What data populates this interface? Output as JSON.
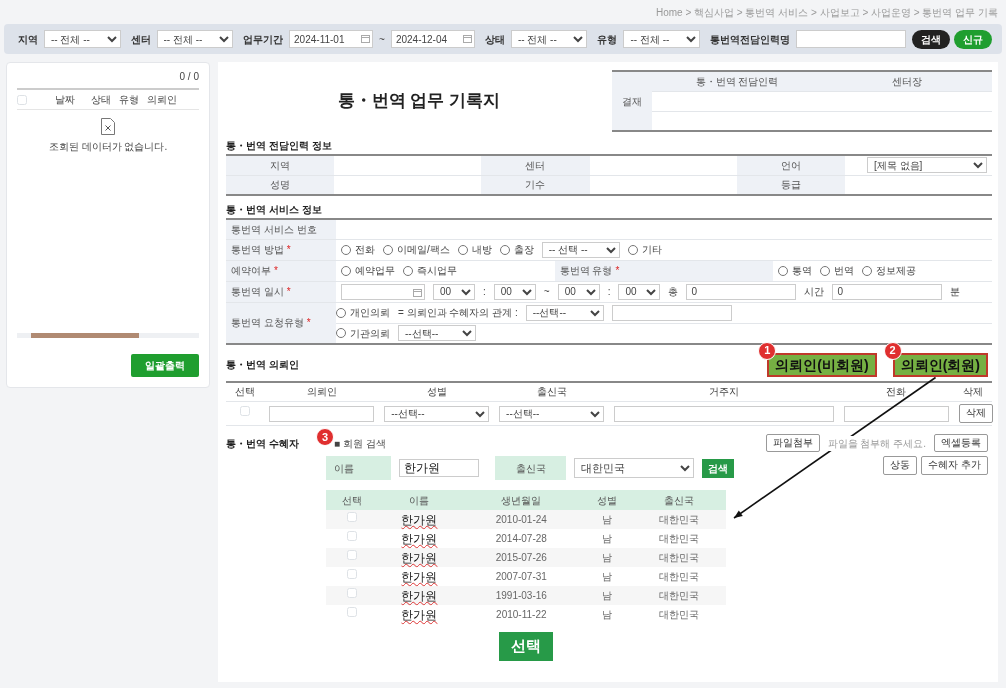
{
  "breadcrumb": "Home > 핵심사업 > 통번역 서비스 > 사업보고 > 사업운영 > 통번역 업무 기록",
  "filters": [
    {
      "kind": "select",
      "label": "지역",
      "value": "-- 전체 --"
    },
    {
      "kind": "select",
      "label": "센터",
      "value": "-- 전체 --"
    },
    {
      "kind": "daterange",
      "label": "업무기간",
      "from": "2024-11-01",
      "separator": "~",
      "to": "2024-12-04"
    },
    {
      "kind": "select",
      "label": "상태",
      "value": "-- 전체 --"
    },
    {
      "kind": "select",
      "label": "유형",
      "value": "-- 전체 --"
    },
    {
      "kind": "input",
      "label": "통번역전담인력명"
    }
  ],
  "filter_buttons": [
    {
      "kind": "dark",
      "label": "검색"
    },
    {
      "kind": "green",
      "label": "신규"
    }
  ],
  "list_panel": {
    "count": "0 / 0",
    "header_checked": false,
    "columns": [
      "날짜",
      "상태",
      "유형",
      "의뢰인"
    ],
    "empty_message": "조회된 데이터가 없습니다.",
    "button": "일괄출력"
  },
  "form": {
    "title": "통・번역 업무 기록지",
    "approval": {
      "label": "결재",
      "columns": [
        "통・번역 전담인력",
        "센터장"
      ]
    },
    "staff": {
      "heading": "통・번역 전담인력 정보",
      "rows": [
        [
          {
            "label": "지역"
          },
          {
            "label": "센터"
          },
          {
            "label": "언어",
            "select": "[제목 없음]"
          }
        ],
        [
          {
            "label": "성명"
          },
          {
            "label": "기수"
          },
          {
            "label": "등급"
          }
        ]
      ]
    },
    "service": {
      "heading": "통・번역 서비스 정보",
      "rows": [
        [
          {
            "label": "통번역 서비스 번호"
          }
        ],
        [
          {
            "label": "통번역 방법",
            "mark": "*",
            "lines": [
              [
                {
                  "kind": "radio",
                  "label": "전화",
                  "checked": false
                },
                {
                  "kind": "radio",
                  "label": "이메일/팩스",
                  "checked": false
                },
                {
                  "kind": "radio",
                  "label": "내방",
                  "checked": false
                },
                {
                  "kind": "radio",
                  "label": "출장",
                  "checked": false
                },
                {
                  "kind": "select",
                  "value": "-- 선택 --"
                },
                {
                  "kind": "radio",
                  "label": "기타",
                  "checked": false
                }
              ]
            ]
          }
        ],
        [
          {
            "label": "예약여부",
            "mark": "*",
            "lines": [
              [
                {
                  "kind": "radio",
                  "label": "예약업무",
                  "checked": false
                },
                {
                  "kind": "radio",
                  "label": "즉시업무",
                  "checked": false
                }
              ]
            ]
          },
          {
            "label": "통번역 유형",
            "mark": "*",
            "lines": [
              [
                {
                  "kind": "radio",
                  "label": "통역",
                  "checked": false
                },
                {
                  "kind": "radio",
                  "label": "번역",
                  "checked": false
                },
                {
                  "kind": "radio",
                  "label": "정보제공",
                  "checked": false
                }
              ]
            ]
          }
        ],
        [
          {
            "label": "통번역 일시",
            "mark": "*",
            "lines": [
              [
                {
                  "kind": "date"
                },
                {
                  "kind": "time",
                  "value": "00"
                },
                {
                  "kind": "text",
                  "value": ":"
                },
                {
                  "kind": "time",
                  "value": "00"
                },
                {
                  "kind": "text",
                  "value": "~"
                },
                {
                  "kind": "time",
                  "value": "00"
                },
                {
                  "kind": "text",
                  "value": ":"
                },
                {
                  "kind": "time",
                  "value": "00"
                },
                {
                  "kind": "text",
                  "value": "총"
                },
                {
                  "kind": "input",
                  "value": "0"
                },
                {
                  "kind": "text",
                  "value": "시간"
                },
                {
                  "kind": "input",
                  "value": "0"
                },
                {
                  "kind": "text",
                  "value": "분"
                }
              ]
            ]
          }
        ],
        [
          {
            "label": "통번역 요청유형",
            "mark": "*",
            "lines": [
              [
                {
                  "kind": "radio",
                  "label": "개인의뢰",
                  "checked": false
                },
                {
                  "kind": "text",
                  "value": "= 의뢰인과 수혜자의 관계 :"
                },
                {
                  "kind": "select",
                  "value": "--선택--"
                },
                {
                  "kind": "input"
                }
              ],
              [
                {
                  "kind": "radio",
                  "label": "기관의뢰",
                  "checked": false
                },
                {
                  "kind": "select",
                  "value": "--선택--"
                }
              ]
            ]
          }
        ]
      ]
    },
    "client": {
      "heading": "통・번역 의뢰인",
      "buttons": [
        {
          "label": "의뢰인(비회원)",
          "callout": "1"
        },
        {
          "label": "의뢰인(회원)",
          "callout": "2"
        }
      ],
      "columns": [
        "선택",
        "의뢰인",
        "성별",
        "출신국",
        "거주지",
        "전화",
        "삭제"
      ],
      "rows": [
        {
          "selected": false,
          "gender": "--선택--",
          "country": "--선택--",
          "delete_button": "삭제"
        }
      ]
    },
    "recipient": {
      "heading": "통・번역 수혜자",
      "toolbar": [
        {
          "kind": "button",
          "label": "파일첨부"
        },
        {
          "kind": "hint",
          "label": "파일을 첨부해 주세요."
        },
        {
          "kind": "button",
          "label": "엑셀등록"
        },
        {
          "kind": "button",
          "label": "상동"
        },
        {
          "kind": "button",
          "label": "수혜자 추가"
        }
      ]
    }
  },
  "member_search": {
    "callout": "3",
    "title": "■ 회원 검색",
    "name_label": "이름",
    "name_value": "한가원",
    "country_label": "출신국",
    "country_value": "대한민국",
    "search_button": "검색",
    "columns": [
      "선택",
      "이름",
      "생년월일",
      "성별",
      "출신국"
    ],
    "rows": [
      {
        "selected": false,
        "name": "한가원",
        "birth": "2010-01-24",
        "gender": "남",
        "country": "대한민국"
      },
      {
        "selected": false,
        "name": "한가원",
        "birth": "2014-07-28",
        "gender": "남",
        "country": "대한민국"
      },
      {
        "selected": false,
        "name": "한가원",
        "birth": "2015-07-26",
        "gender": "남",
        "country": "대한민국"
      },
      {
        "selected": false,
        "name": "한가원",
        "birth": "2007-07-31",
        "gender": "남",
        "country": "대한민국"
      },
      {
        "selected": false,
        "name": "한가원",
        "birth": "1991-03-16",
        "gender": "남",
        "country": "대한민국"
      },
      {
        "selected": false,
        "name": "한가원",
        "birth": "2010-11-22",
        "gender": "남",
        "country": "대한민국"
      }
    ],
    "select_button": "선택"
  }
}
